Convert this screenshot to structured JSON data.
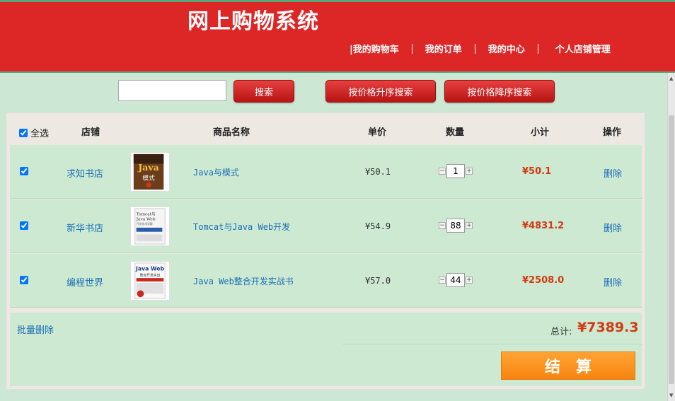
{
  "header": {
    "title": "网上购物系统",
    "nav": [
      "|我的购物车",
      "我的订单",
      "我的中心",
      "个人店铺管理"
    ]
  },
  "toolbar": {
    "search_value": "",
    "search_label": "搜索",
    "sort_asc_label": "按价格升序搜索",
    "sort_desc_label": "按价格降序搜索"
  },
  "cart": {
    "headers": {
      "select_all": "全选",
      "shop": "店铺",
      "name": "商品名称",
      "price": "单价",
      "qty": "数量",
      "subtotal": "小计",
      "action": "操作"
    },
    "items": [
      {
        "shop": "求知书店",
        "name": "Java与模式",
        "price": "¥50.1",
        "qty": "1",
        "subtotal": "¥50.1",
        "action": "删除",
        "cover_icon": "book-cover-java-patterns"
      },
      {
        "shop": "新华书店",
        "name": "Tomcat与Java Web开发",
        "price": "¥54.9",
        "qty": "88",
        "subtotal": "¥4831.2",
        "action": "删除",
        "cover_icon": "book-cover-tomcat"
      },
      {
        "shop": "编程世界",
        "name": "Java Web整合开发实战书",
        "price": "¥57.0",
        "qty": "44",
        "subtotal": "¥2508.0",
        "action": "删除",
        "cover_icon": "book-cover-javaweb"
      }
    ],
    "batch_delete": "批量删除",
    "total_label": "总计:",
    "total_value": "¥7389.3",
    "checkout_label": "结算"
  },
  "colors": {
    "header_bg": "#dd2727",
    "page_bg": "#cce8d4",
    "price_red": "#d23a12",
    "link_blue": "#1b6fb5",
    "checkout_orange": "#f7850f"
  }
}
